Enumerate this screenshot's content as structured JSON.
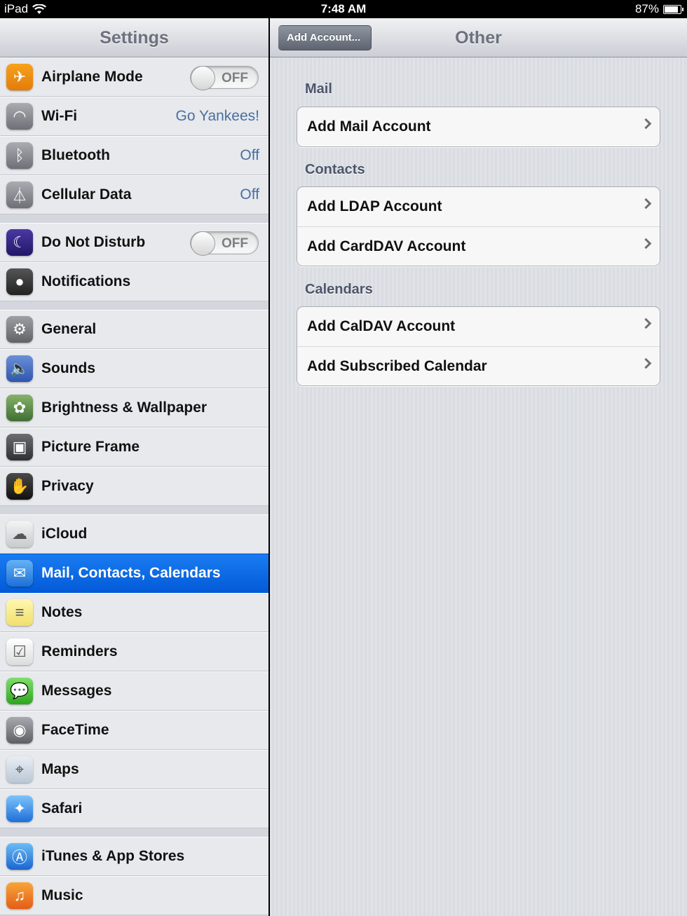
{
  "status_bar": {
    "carrier": "iPad",
    "time": "7:48 AM",
    "battery": "87%"
  },
  "master": {
    "title": "Settings",
    "groups": [
      [
        {
          "label": "Airplane Mode",
          "icon": "airplane-icon",
          "toggle": "OFF"
        },
        {
          "label": "Wi-Fi",
          "icon": "wifi-icon",
          "value": "Go Yankees!"
        },
        {
          "label": "Bluetooth",
          "icon": "bluetooth-icon",
          "value": "Off"
        },
        {
          "label": "Cellular Data",
          "icon": "cellular-icon",
          "value": "Off"
        }
      ],
      [
        {
          "label": "Do Not Disturb",
          "icon": "moon-icon",
          "toggle": "OFF"
        },
        {
          "label": "Notifications",
          "icon": "notifications-icon"
        }
      ],
      [
        {
          "label": "General",
          "icon": "gear-icon"
        },
        {
          "label": "Sounds",
          "icon": "speaker-icon"
        },
        {
          "label": "Brightness & Wallpaper",
          "icon": "flower-icon"
        },
        {
          "label": "Picture Frame",
          "icon": "picture-frame-icon"
        },
        {
          "label": "Privacy",
          "icon": "hand-icon"
        }
      ],
      [
        {
          "label": "iCloud",
          "icon": "cloud-icon"
        },
        {
          "label": "Mail, Contacts, Calendars",
          "icon": "mail-icon",
          "selected": true
        },
        {
          "label": "Notes",
          "icon": "notes-icon"
        },
        {
          "label": "Reminders",
          "icon": "reminders-icon"
        },
        {
          "label": "Messages",
          "icon": "messages-icon"
        },
        {
          "label": "FaceTime",
          "icon": "facetime-icon"
        },
        {
          "label": "Maps",
          "icon": "maps-icon"
        },
        {
          "label": "Safari",
          "icon": "safari-icon"
        }
      ],
      [
        {
          "label": "iTunes & App Stores",
          "icon": "app-store-icon"
        },
        {
          "label": "Music",
          "icon": "music-icon"
        }
      ]
    ]
  },
  "detail": {
    "back_label": "Add Account...",
    "title": "Other",
    "sections": {
      "mail": {
        "header": "Mail",
        "rows": [
          "Add Mail Account"
        ]
      },
      "contacts": {
        "header": "Contacts",
        "rows": [
          "Add LDAP Account",
          "Add CardDAV Account"
        ]
      },
      "calendars": {
        "header": "Calendars",
        "rows": [
          "Add CalDAV Account",
          "Add Subscribed Calendar"
        ]
      }
    }
  },
  "colors": {
    "selection": "#035ad8",
    "value_text": "#4a6fa1",
    "section_header": "#4c566a"
  }
}
